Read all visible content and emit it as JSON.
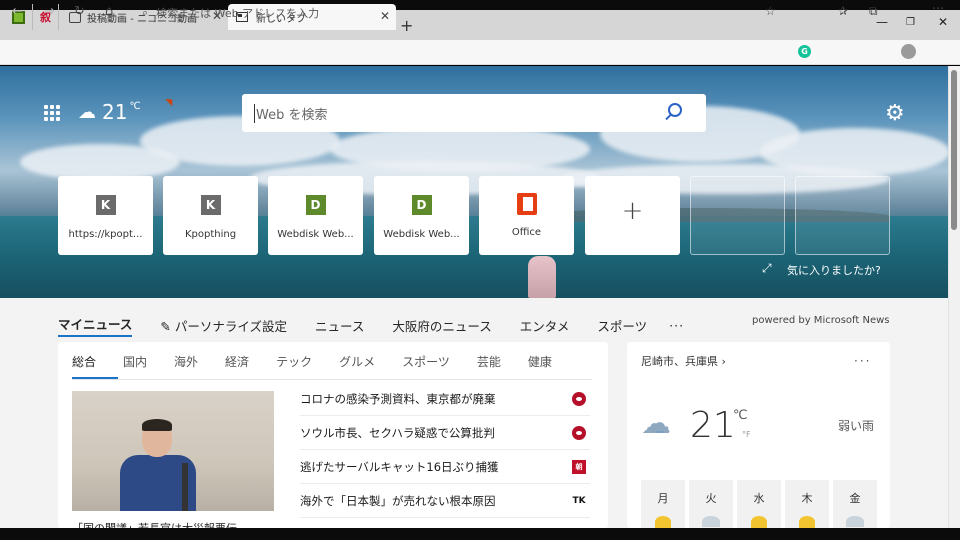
{
  "tabs": {
    "pinned_red_glyph": "叙",
    "niconico_title": "投稿動画 - ニコニコ動画",
    "newtab_title": "新しいタブ",
    "close_glyph": "✕",
    "new_tab_glyph": "+"
  },
  "window_controls": {
    "minimize": "—",
    "maximize": "❐",
    "close": "✕"
  },
  "toolbar": {
    "back": "←",
    "forward": "→",
    "reload": "↻",
    "home": "⌂",
    "address_placeholder": "検索または Web アドレスを入力",
    "star": "☆",
    "favorites": "✰",
    "collections": "⧉",
    "more": "···",
    "grammarly_letter": "G"
  },
  "hero": {
    "temperature": "21",
    "temp_unit": "℃",
    "search_placeholder": "Web を検索",
    "gear": "⚙",
    "expand_icon": "⤢",
    "like_prompt": "気に入りましたか?"
  },
  "tiles": [
    {
      "badge": "K",
      "label": "https://kpopt...",
      "color": "#6b6b6b"
    },
    {
      "badge": "K",
      "label": "Kpopthing",
      "color": "#6b6b6b"
    },
    {
      "badge": "D",
      "label": "Webdisk Web...",
      "color": "#5e8a2c"
    },
    {
      "badge": "D",
      "label": "Webdisk Web...",
      "color": "#5e8a2c"
    },
    {
      "badge": "",
      "label": "Office",
      "color": "#e53e12"
    }
  ],
  "add_tile_glyph": "+",
  "news_nav": {
    "items": [
      "マイニュース",
      "✎ パーソナライズ設定",
      "ニュース",
      "大阪府のニュース",
      "エンタメ",
      "スポーツ"
    ],
    "more": "···",
    "powered_by": "powered by Microsoft News"
  },
  "categories": [
    "総合",
    "国内",
    "海外",
    "経済",
    "テック",
    "グルメ",
    "スポーツ",
    "芸能",
    "健康"
  ],
  "headlines": [
    {
      "text": "コロナの感染予測資料、東京都が廃棄",
      "source": ""
    },
    {
      "text": "ソウル市長、セクハラ疑惑で公算批判",
      "source": ""
    },
    {
      "text": "逃げたサーバルキャット16日ぶり捕獲",
      "source": "朝"
    },
    {
      "text": "海外で「日本製」が売れない根本原因",
      "source": "TK"
    },
    {
      "text": "",
      "source": ""
    }
  ],
  "photo_caption": "「国の閣議」若長官は大災報悪伝...",
  "weather": {
    "location": "尼崎市、兵庫県 ›",
    "more": "···",
    "temperature": "21",
    "unit_c": "℃",
    "unit_f": "°F",
    "condition": "弱い雨",
    "cloud_icon": "☁",
    "rain_icon": "ᐧᐧᐧ",
    "days": [
      {
        "label": "月",
        "icon": "sun"
      },
      {
        "label": "火",
        "icon": "cloud"
      },
      {
        "label": "水",
        "icon": "sun"
      },
      {
        "label": "木",
        "icon": "sun"
      },
      {
        "label": "金",
        "icon": "cloud"
      }
    ]
  }
}
